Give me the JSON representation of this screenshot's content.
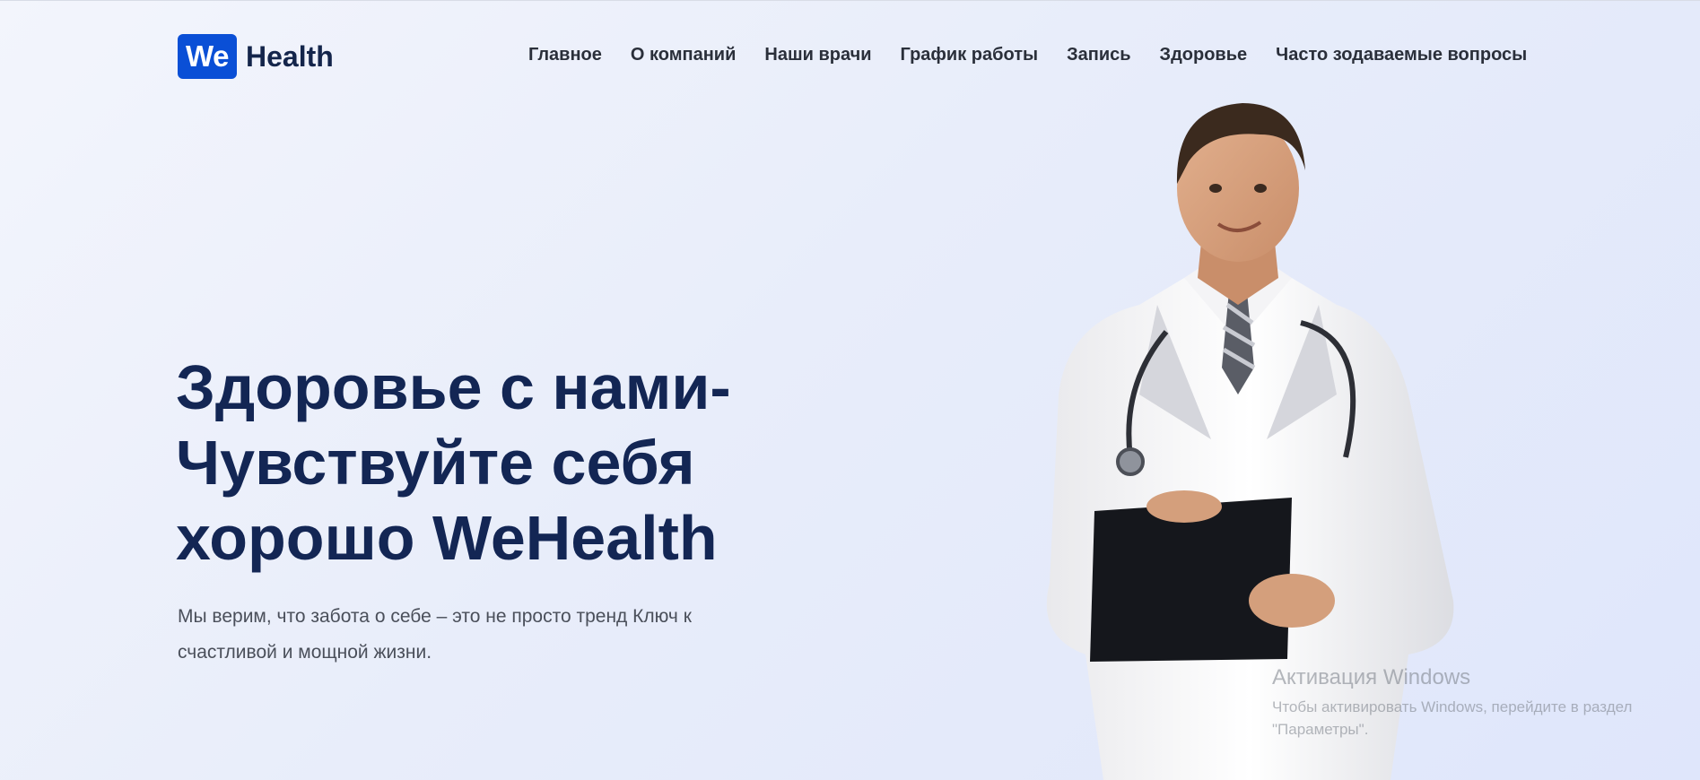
{
  "logo": {
    "mark": "We",
    "text": "Health"
  },
  "nav": {
    "items": [
      {
        "label": "Главное"
      },
      {
        "label": "О компаний"
      },
      {
        "label": "Наши врачи"
      },
      {
        "label": "График работы"
      },
      {
        "label": "Запись"
      },
      {
        "label": "Здоровье"
      },
      {
        "label": "Часто зодаваемые вопросы"
      }
    ]
  },
  "hero": {
    "title_line1": "Здоровье с нами-",
    "title_line2": "Чувствуйте себя",
    "title_line3": "хорошо WeHealth",
    "text_line1": "Мы верим, что забота о себе – это не просто тренд Ключ к",
    "text_line2": "счастливой и мощной жизни."
  },
  "windows_watermark": {
    "title": "Активация Windows",
    "line1": "Чтобы активировать Windows, перейдите в раздел",
    "line2": "\"Параметры\"."
  },
  "colors": {
    "brand": "#0a4fd6",
    "heading": "#132654"
  }
}
